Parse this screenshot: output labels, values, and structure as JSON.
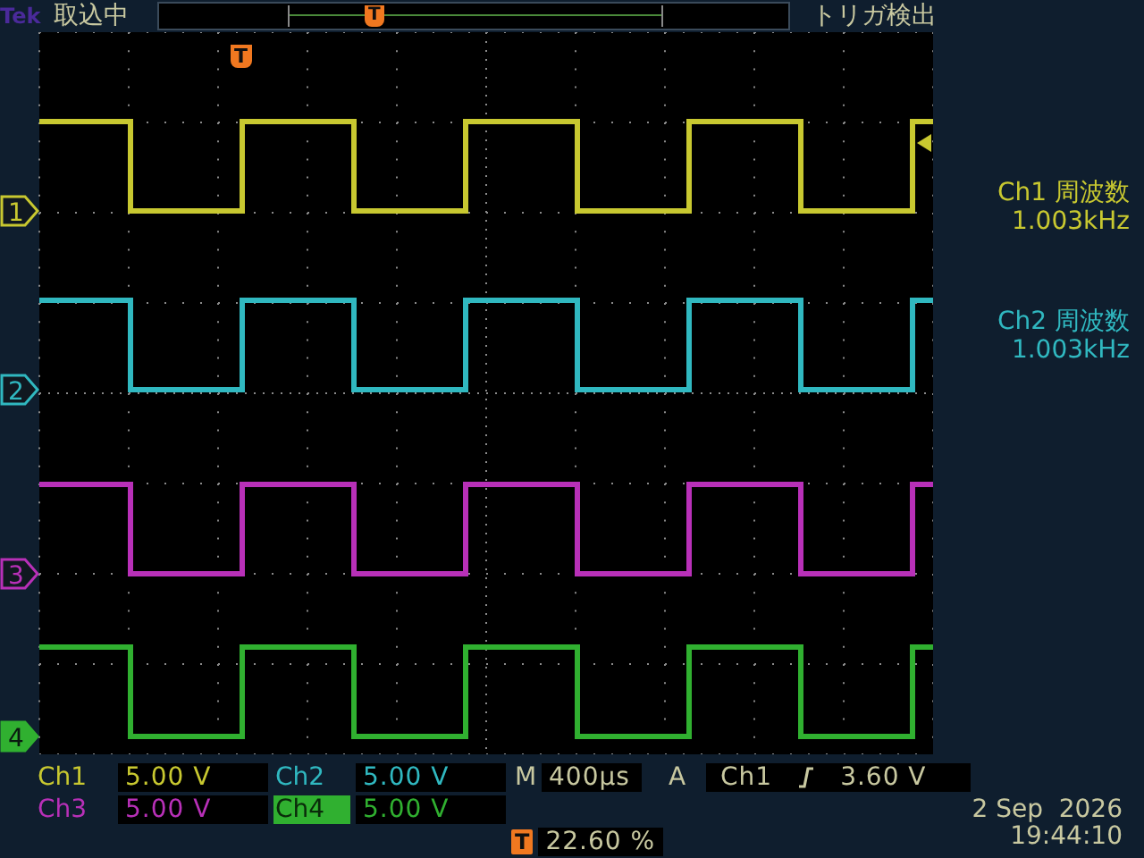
{
  "header": {
    "logo": "Tek",
    "acquisition_status": "取込中",
    "trigger_marker": "T",
    "trigger_status": "トリガ検出"
  },
  "graticule": {
    "trigger_marker": "T"
  },
  "channels": [
    {
      "label": "Ch1",
      "marker": "1",
      "scale": "5.00 V",
      "color": "#c8c830",
      "highlighted": false
    },
    {
      "label": "Ch2",
      "marker": "2",
      "scale": "5.00 V",
      "color": "#30b8c0",
      "highlighted": false
    },
    {
      "label": "Ch3",
      "marker": "3",
      "scale": "5.00 V",
      "color": "#b830b8",
      "highlighted": false
    },
    {
      "label": "Ch4",
      "marker": "4",
      "scale": "5.00 V",
      "color": "#30b030",
      "highlighted": true
    }
  ],
  "measurements": [
    {
      "label": "Ch1 周波数",
      "value": "1.003kHz",
      "color": "#c8c830"
    },
    {
      "label": "Ch2 周波数",
      "value": "1.003kHz",
      "color": "#30b8c0"
    }
  ],
  "timebase": {
    "label": "M",
    "value": "400µs"
  },
  "trigger": {
    "label": "A",
    "source": "Ch1",
    "level": "3.60 V"
  },
  "trigger_position": {
    "marker": "T",
    "value": "22.60 %"
  },
  "date": "2 Sep  2026",
  "time": "19:44:10"
}
